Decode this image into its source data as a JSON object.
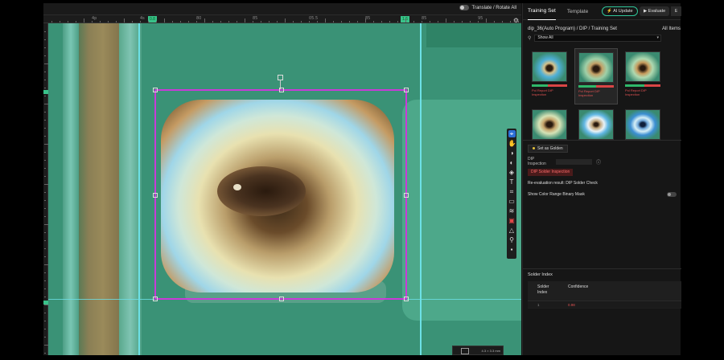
{
  "viewer": {
    "translate_label": "Translate / Rotate All",
    "ruler_ticks": [
      "4p",
      "4s",
      "80",
      "85",
      "05.5",
      "85",
      "85",
      "95"
    ],
    "ruler_markers": [
      "0.8",
      "1.6"
    ],
    "nav_size": "4.3 × 3.3 mm",
    "nav_coords": "X 53.9 Y 75.3"
  },
  "tools": [
    {
      "icon": "select-icon",
      "glyph": "⌖",
      "active": true
    },
    {
      "icon": "hand-icon",
      "glyph": "✋"
    },
    {
      "icon": "contrast-icon",
      "glyph": "◑"
    },
    {
      "icon": "invert-icon",
      "glyph": "◐"
    },
    {
      "icon": "layers-icon",
      "glyph": "◈"
    },
    {
      "icon": "text-icon",
      "glyph": "T"
    },
    {
      "icon": "grid-icon",
      "glyph": "⌗"
    },
    {
      "icon": "comment-icon",
      "glyph": "▭"
    },
    {
      "icon": "filter-icon",
      "glyph": "≋"
    },
    {
      "icon": "flag-icon",
      "glyph": "▣",
      "red": true
    },
    {
      "icon": "warning-icon",
      "glyph": "△"
    },
    {
      "icon": "pin-icon",
      "glyph": "⚲"
    },
    {
      "icon": "delete-icon",
      "glyph": "▪"
    }
  ],
  "panel": {
    "tabs": [
      "Training Set",
      "Template"
    ],
    "ai_update": "AI Update",
    "evaluate": "Evaluate",
    "extra": "E",
    "breadcrumb": "dip_36(Auto Program) / DIP / Training Set",
    "all_items": "All Items",
    "filter_value": "Show All",
    "cards": [
      {
        "label": "Pol Report DIP Inspection",
        "g": 0.45,
        "r": 0.55,
        "selected": false
      },
      {
        "label": "Pol Report DIP Inspection",
        "g": 0.5,
        "r": 0.5,
        "selected": true
      },
      {
        "label": "Pol Report DIP Inspection",
        "g": 0.55,
        "r": 0.45,
        "selected": false
      },
      {
        "label": "",
        "g": 0,
        "r": 0,
        "selected": false
      },
      {
        "label": "",
        "g": 0,
        "r": 0,
        "selected": false
      },
      {
        "label": "",
        "g": 0,
        "r": 0,
        "selected": false
      }
    ],
    "set_golden": "Set as Golden",
    "dip_inspection": "DIP Inspection",
    "dip_badge": "DIP Solder Inspection",
    "re_eval": "Re-evaluation result: DIP Solder Check",
    "color_mask": "Show Color Range Binary Mask",
    "solder_title": "Solder Index",
    "col_index": "Solder Index",
    "col_conf": "Confidence",
    "row_index": "1",
    "row_conf": "0.98"
  },
  "colors": {
    "accent": "#2fc69a",
    "roi": "#c93bd8",
    "guide": "#6de0e6",
    "fail": "#e05252",
    "pass": "#2fb86a"
  }
}
